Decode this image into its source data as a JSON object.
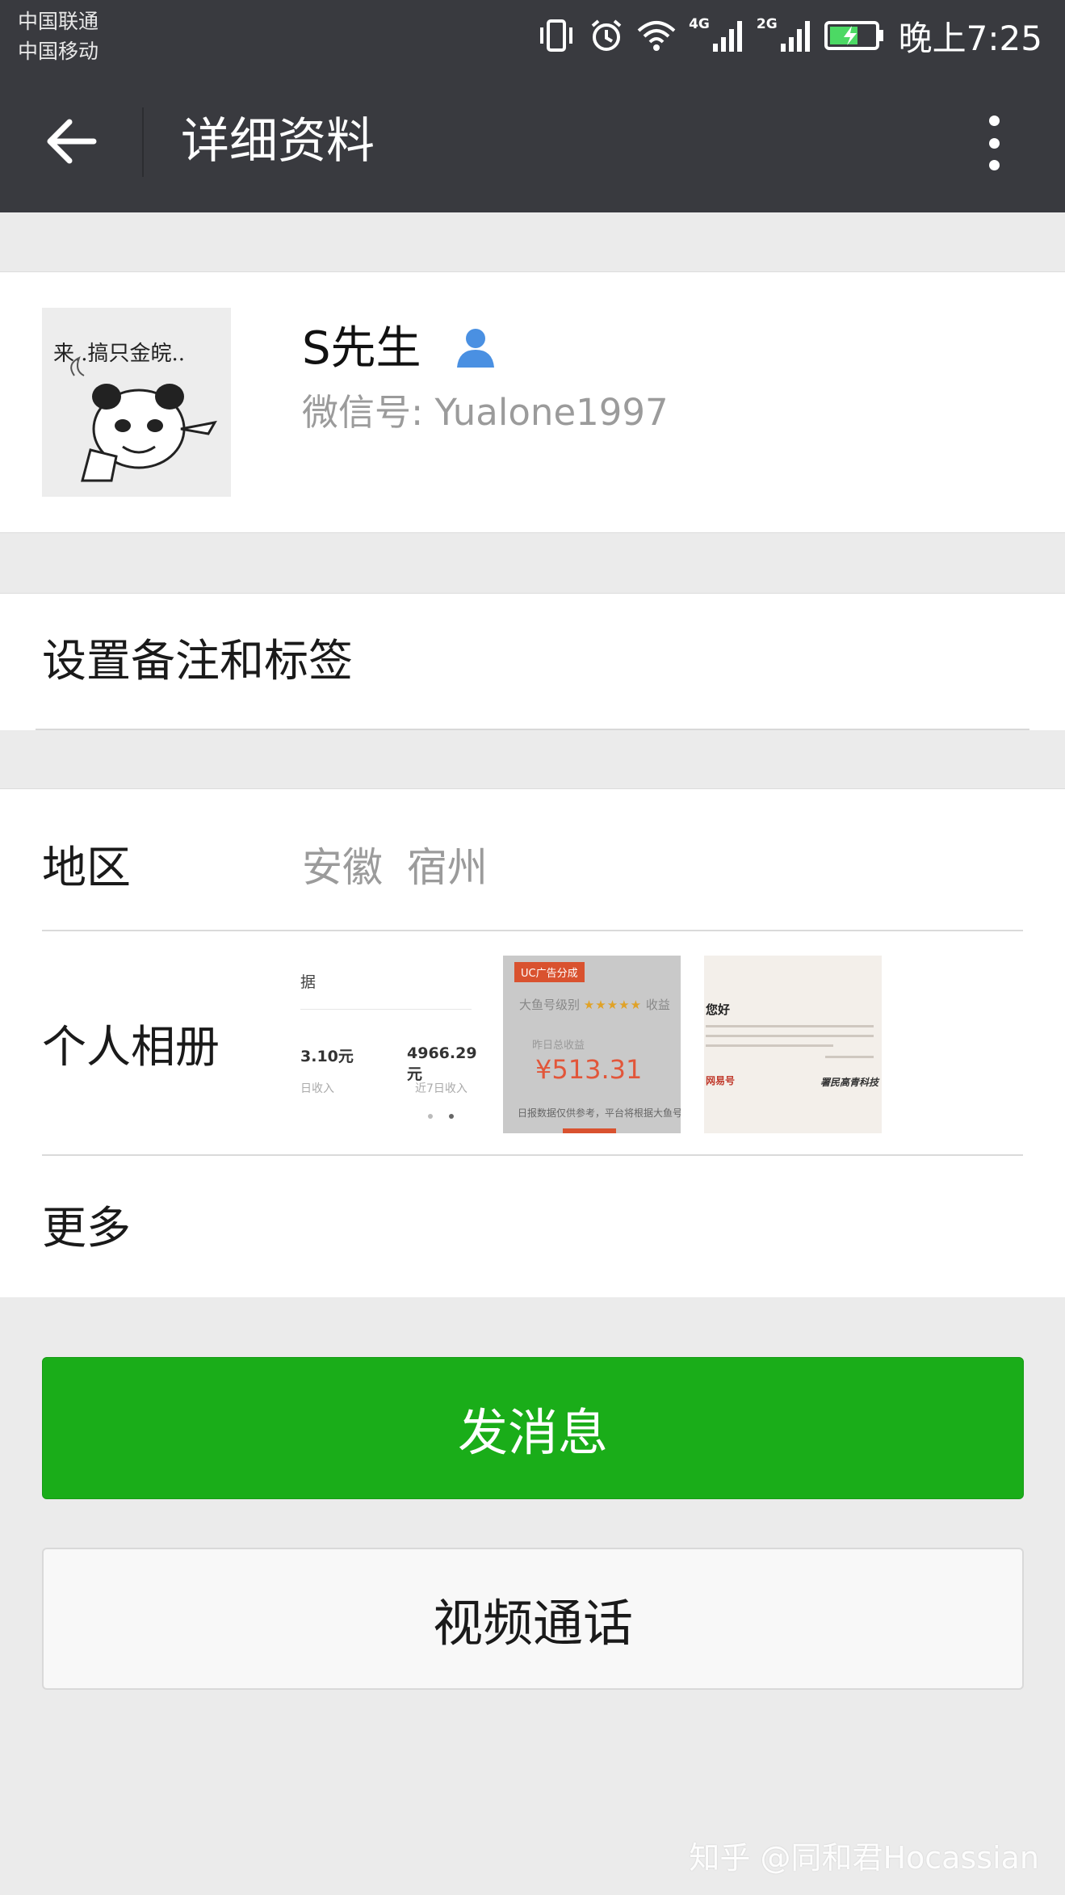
{
  "status_bar": {
    "carrier_1": "中国联通",
    "carrier_2": "中国移动",
    "network_1": "4G",
    "network_2": "2G",
    "time": "晚上7:25"
  },
  "header": {
    "title": "详细资料"
  },
  "profile": {
    "avatar_caption": "来..搞只金皖..",
    "name": "S先生",
    "wechat_id": "微信号: Yualone1997"
  },
  "remark": {
    "label": "设置备注和标签"
  },
  "info": {
    "region_label": "地区",
    "region_value": "安徽  宿州",
    "album_label": "个人相册",
    "more_label": "更多"
  },
  "album": {
    "thumb1": {
      "heading": "据",
      "value_1": "3.10元",
      "value_2": "4966.29元",
      "sub_1": "日收入",
      "sub_2": "近7日收入"
    },
    "thumb2": {
      "badge": "UC广告分成",
      "heading": "大鱼号级别",
      "stars": "★★★★★",
      "heading_suffix": "收益",
      "sub": "昨日总收益",
      "amount": "¥513.31",
      "foot": "日报数据仅供参考，平台将根据大鱼号可能的"
    },
    "thumb3": {
      "heading": "您好",
      "logo": "网易号",
      "sign": "署民高青科技"
    }
  },
  "actions": {
    "send_message": "发消息",
    "video_call": "视频通话"
  },
  "watermark": "知乎 @同和君Hocassian",
  "colors": {
    "header_bg": "#393a3f",
    "page_bg": "#ebebeb",
    "primary_green": "#1aad19",
    "secondary_text": "#9b9b9b",
    "verify_blue": "#4a90e2"
  }
}
